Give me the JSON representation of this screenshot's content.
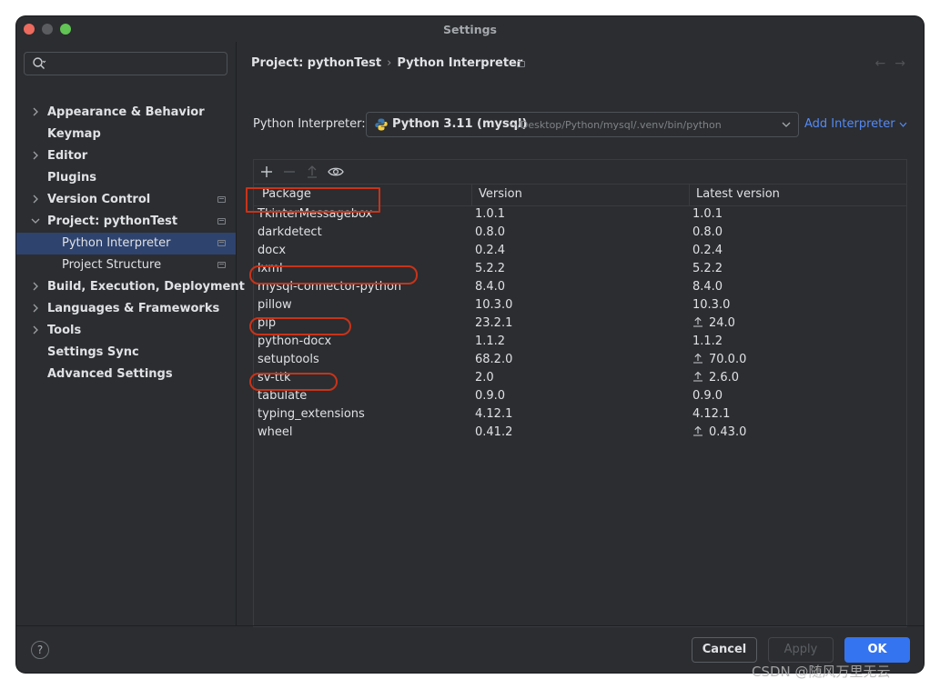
{
  "window": {
    "title": "Settings"
  },
  "sidebar": {
    "search_placeholder": "",
    "items": [
      {
        "label": "Appearance & Behavior"
      },
      {
        "label": "Keymap"
      },
      {
        "label": "Editor"
      },
      {
        "label": "Plugins"
      },
      {
        "label": "Version Control"
      },
      {
        "label": "Project: pythonTest"
      },
      {
        "label": "Python Interpreter"
      },
      {
        "label": "Project Structure"
      },
      {
        "label": "Build, Execution, Deployment"
      },
      {
        "label": "Languages & Frameworks"
      },
      {
        "label": "Tools"
      },
      {
        "label": "Settings Sync"
      },
      {
        "label": "Advanced Settings"
      }
    ]
  },
  "breadcrumb": {
    "project": "Project: pythonTest",
    "page": "Python Interpreter"
  },
  "interpreter": {
    "label": "Python Interpreter:",
    "name": "Python 3.11 (mysql)",
    "path": "~/Desktop/Python/mysql/.venv/bin/python",
    "add_label": "Add Interpreter"
  },
  "packages": {
    "columns": [
      "Package",
      "Version",
      "Latest version"
    ],
    "rows": [
      {
        "name": "TkinterMessagebox",
        "version": "1.0.1",
        "latest": "1.0.1",
        "upgrade": false
      },
      {
        "name": "darkdetect",
        "version": "0.8.0",
        "latest": "0.8.0",
        "upgrade": false
      },
      {
        "name": "docx",
        "version": "0.2.4",
        "latest": "0.2.4",
        "upgrade": false
      },
      {
        "name": "lxml",
        "version": "5.2.2",
        "latest": "5.2.2",
        "upgrade": false
      },
      {
        "name": "mysql-connector-python",
        "version": "8.4.0",
        "latest": "8.4.0",
        "upgrade": false
      },
      {
        "name": "pillow",
        "version": "10.3.0",
        "latest": "10.3.0",
        "upgrade": false
      },
      {
        "name": "pip",
        "version": "23.2.1",
        "latest": "24.0",
        "upgrade": true
      },
      {
        "name": "python-docx",
        "version": "1.1.2",
        "latest": "1.1.2",
        "upgrade": false
      },
      {
        "name": "setuptools",
        "version": "68.2.0",
        "latest": "70.0.0",
        "upgrade": true
      },
      {
        "name": "sv-ttk",
        "version": "2.0",
        "latest": "2.6.0",
        "upgrade": true
      },
      {
        "name": "tabulate",
        "version": "0.9.0",
        "latest": "0.9.0",
        "upgrade": false
      },
      {
        "name": "typing_extensions",
        "version": "4.12.1",
        "latest": "4.12.1",
        "upgrade": false
      },
      {
        "name": "wheel",
        "version": "0.41.2",
        "latest": "0.43.0",
        "upgrade": true
      }
    ]
  },
  "footer": {
    "help": "?",
    "cancel": "Cancel",
    "apply": "Apply",
    "ok": "OK"
  },
  "watermark": "CSDN @随风万里无云",
  "colors": {
    "accent": "#3574f0",
    "link": "#548af7",
    "selection": "#2e436e",
    "annotation": "#c8331a"
  }
}
